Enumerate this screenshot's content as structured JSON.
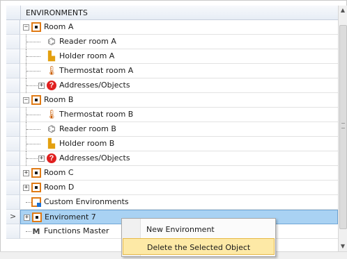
{
  "header": {
    "title": "ENVIRONMENTS"
  },
  "tree": [
    {
      "label": "Room A",
      "icon": "room-icon",
      "level": 0,
      "expander": "−"
    },
    {
      "label": "Reader room A",
      "icon": "card-reader-icon",
      "level": 1
    },
    {
      "label": "Holder room A",
      "icon": "card-holder-icon",
      "level": 1
    },
    {
      "label": "Thermostat room A",
      "icon": "thermostat-icon",
      "level": 1
    },
    {
      "label": "Addresses/Objects",
      "icon": "question-icon",
      "level": 1,
      "expander": "+"
    },
    {
      "label": "Room B",
      "icon": "room-icon",
      "level": 0,
      "expander": "−"
    },
    {
      "label": "Thermostat room B",
      "icon": "thermostat-icon",
      "level": 1
    },
    {
      "label": "Reader room B",
      "icon": "card-reader-icon",
      "level": 1
    },
    {
      "label": "Holder room B",
      "icon": "card-holder-icon",
      "level": 1
    },
    {
      "label": "Addresses/Objects",
      "icon": "question-icon",
      "level": 1,
      "expander": "+"
    },
    {
      "label": "Room C",
      "icon": "room-icon",
      "level": 0,
      "expander": "+"
    },
    {
      "label": "Room D",
      "icon": "room-icon",
      "level": 0,
      "expander": "+"
    },
    {
      "label": "Custom Environments",
      "icon": "custom-environment-icon",
      "level": 0
    },
    {
      "label": "Enviroment 7",
      "icon": "room-icon",
      "level": 0,
      "expander": "+",
      "selected": true
    },
    {
      "label": "Functions Master",
      "icon": "functions-icon",
      "level": 0
    }
  ],
  "context_menu": {
    "items": [
      {
        "label": "New Environment"
      },
      {
        "label": "Delete the Selected Object",
        "hover": true
      }
    ]
  },
  "row_marker": ">",
  "colors": {
    "selection": "#a9d2f3",
    "room_border": "#e07a14",
    "menu_hover": "#fde9a6"
  }
}
